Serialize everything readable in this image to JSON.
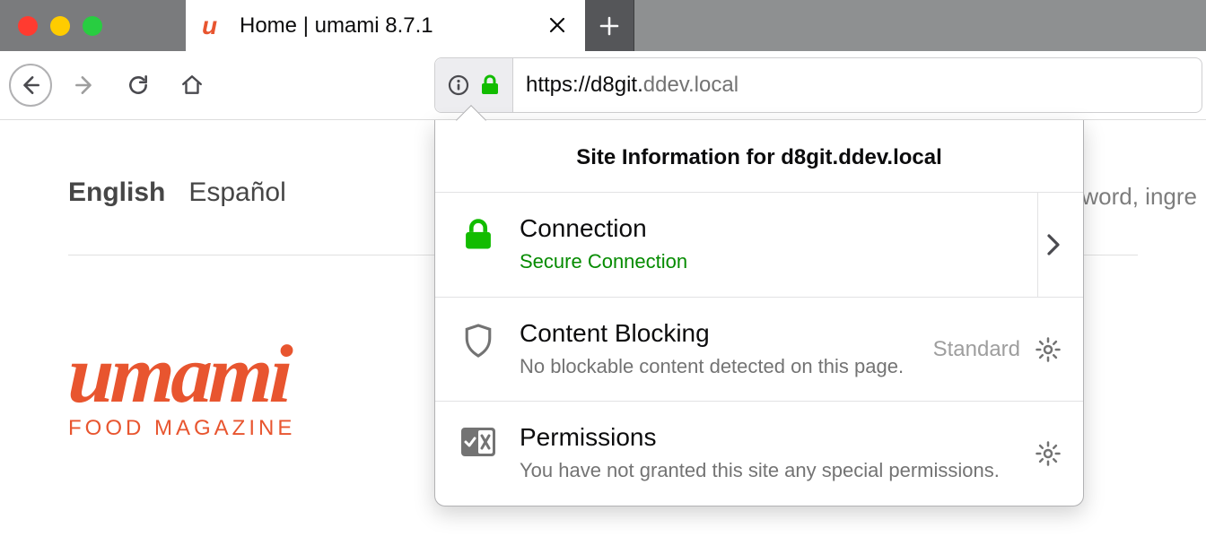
{
  "tab": {
    "title": "Home | umami 8.7.1",
    "favicon_glyph": "u"
  },
  "url": {
    "scheme_host": "https://d8git.",
    "rest": "ddev.local"
  },
  "popup": {
    "header": "Site Information for d8git.ddev.local",
    "connection": {
      "title": "Connection",
      "status": "Secure Connection"
    },
    "blocking": {
      "title": "Content Blocking",
      "level": "Standard",
      "status": "No blockable content detected on this page."
    },
    "permissions": {
      "title": "Permissions",
      "status": "You have not granted this site any special permissions."
    }
  },
  "page": {
    "languages": {
      "active": "English",
      "other": "Español"
    },
    "logo_wordmark": "umami",
    "logo_tagline": "FOOD MAGAZINE",
    "search_hint_fragment": "word, ingre"
  }
}
